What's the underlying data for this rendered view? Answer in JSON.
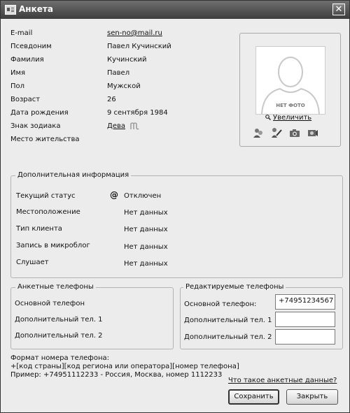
{
  "window": {
    "title": "Анкета",
    "close_glyph": "✕"
  },
  "profile": [
    {
      "label": "E-mail",
      "value": "sen-no@mail.ru",
      "link": true
    },
    {
      "label": "Псевдоним",
      "value": "Павел Кучинский"
    },
    {
      "label": "Фамилия",
      "value": "Кучинский"
    },
    {
      "label": "Имя",
      "value": "Павел"
    },
    {
      "label": "Пол",
      "value": "Мужской"
    },
    {
      "label": "Возраст",
      "value": "26"
    },
    {
      "label": "Дата рождения",
      "value": "9 сентября 1984"
    },
    {
      "label": "Знак зодиака",
      "value": "Дева",
      "link": true,
      "icon": "zodiac-icon"
    },
    {
      "label": "Место жительства",
      "value": ""
    }
  ],
  "photo": {
    "placeholder": "НЕТ ФОТО",
    "enlarge_label": "Увеличить",
    "tools": [
      "contacts-icon",
      "edit-icon",
      "camera-icon",
      "webcam-icon"
    ]
  },
  "additional": {
    "title": "Дополнительная информация",
    "rows": [
      {
        "label": "Текущий статус",
        "value": "Отключен",
        "icon": "at-icon"
      },
      {
        "label": "Местоположение",
        "value": "Нет данных"
      },
      {
        "label": "Тип клиента",
        "value": "Нет данных"
      },
      {
        "label": "Запись в микроблог",
        "value": "Нет данных"
      },
      {
        "label": "Слушает",
        "value": "Нет данных"
      }
    ]
  },
  "profile_phones": {
    "title": "Анкетные телефоны",
    "rows": [
      "Основной телефон",
      "Дополнительный тел. 1",
      "Дополнительный тел. 2"
    ]
  },
  "editable_phones": {
    "title": "Редактируемые телефоны",
    "rows": [
      {
        "label": "Основной телефон:",
        "value": "+74951234567"
      },
      {
        "label": "Дополнительный тел. 1",
        "value": ""
      },
      {
        "label": "Дополнительный тел. 2",
        "value": ""
      }
    ]
  },
  "format_help": {
    "line1": "Формат номера телефона:",
    "line2": "+[код страны][код региона или оператора][номер телефона]",
    "line3": "Пример: +74951112233 - Россия, Москва, номер 1112233"
  },
  "footer": {
    "what_link": "Что такое анкетные данные?",
    "save_label": "Сохранить",
    "close_label": "Закрыть"
  }
}
